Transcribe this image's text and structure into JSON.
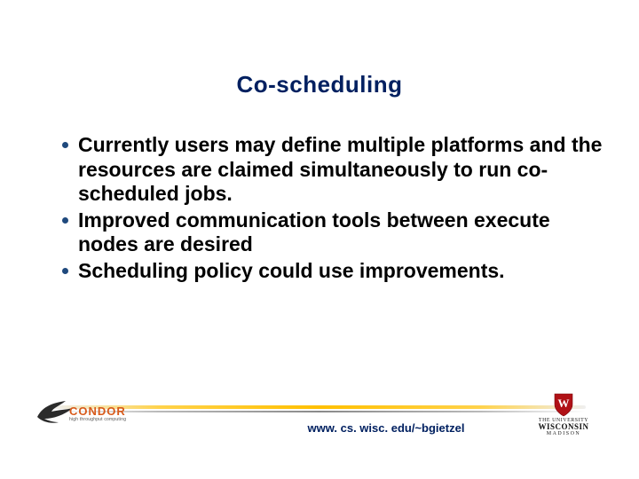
{
  "title": "Co-scheduling",
  "bullets": [
    "Currently users may define multiple platforms and the resources are claimed simultaneously to run co-scheduled jobs.",
    "Improved communication tools between execute nodes are desired",
    "Scheduling policy could use improvements."
  ],
  "footer_url": "www. cs. wisc. edu/~bgietzel",
  "condor": {
    "text": "CONDOR",
    "sub": "high throughput computing"
  },
  "wisc": {
    "top": "THE UNIVERSITY",
    "main": "WISCONSIN",
    "bot": "MADISON"
  }
}
